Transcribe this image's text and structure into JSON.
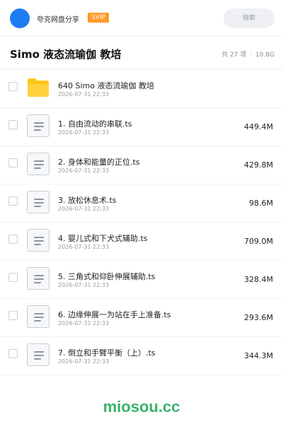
{
  "header": {
    "brand": "夸克网盘分享",
    "badge": "SVIP",
    "search_placeholder": "搜索"
  },
  "folder": {
    "title": "Simo 液态流瑜伽 教培",
    "count": "共 27 项",
    "total_size": "10.8G"
  },
  "files": [
    {
      "name": "640 Simo 液态流瑜伽 教培",
      "date": "2026-07-31 22:33",
      "size": "",
      "icon": "folder-icon"
    },
    {
      "name": "1. 自由流动的串联.ts",
      "date": "2026-07-31 22:33",
      "size": "449.4M",
      "icon": "document-icon"
    },
    {
      "name": "2. 身体和能量的正位.ts",
      "date": "2026-07-31 22:33",
      "size": "429.8M",
      "icon": "document-icon"
    },
    {
      "name": "3. 放松休息术.ts",
      "date": "2026-07-31 22:33",
      "size": "98.6M",
      "icon": "document-icon"
    },
    {
      "name": "4. 婴儿式和下犬式辅助.ts",
      "date": "2026-07-31 22:33",
      "size": "709.0M",
      "icon": "document-icon"
    },
    {
      "name": "5. 三角式和仰卧伸展辅助.ts",
      "date": "2026-07-31 22:33",
      "size": "328.4M",
      "icon": "document-icon"
    },
    {
      "name": "6. 边缘伸展一为站在手上准备.ts",
      "date": "2026-07-31 22:33",
      "size": "293.6M",
      "icon": "document-icon"
    },
    {
      "name": "7. 倒立和手臂平衡（上）.ts",
      "date": "2026-07-31 22:33",
      "size": "344.3M",
      "icon": "document-icon"
    }
  ],
  "watermark": "miosou.cc",
  "colors": {
    "accent": "#1e7bf2",
    "badge": "#ff9a28",
    "watermark": "#39b36a",
    "folder": "#ffc61a"
  }
}
